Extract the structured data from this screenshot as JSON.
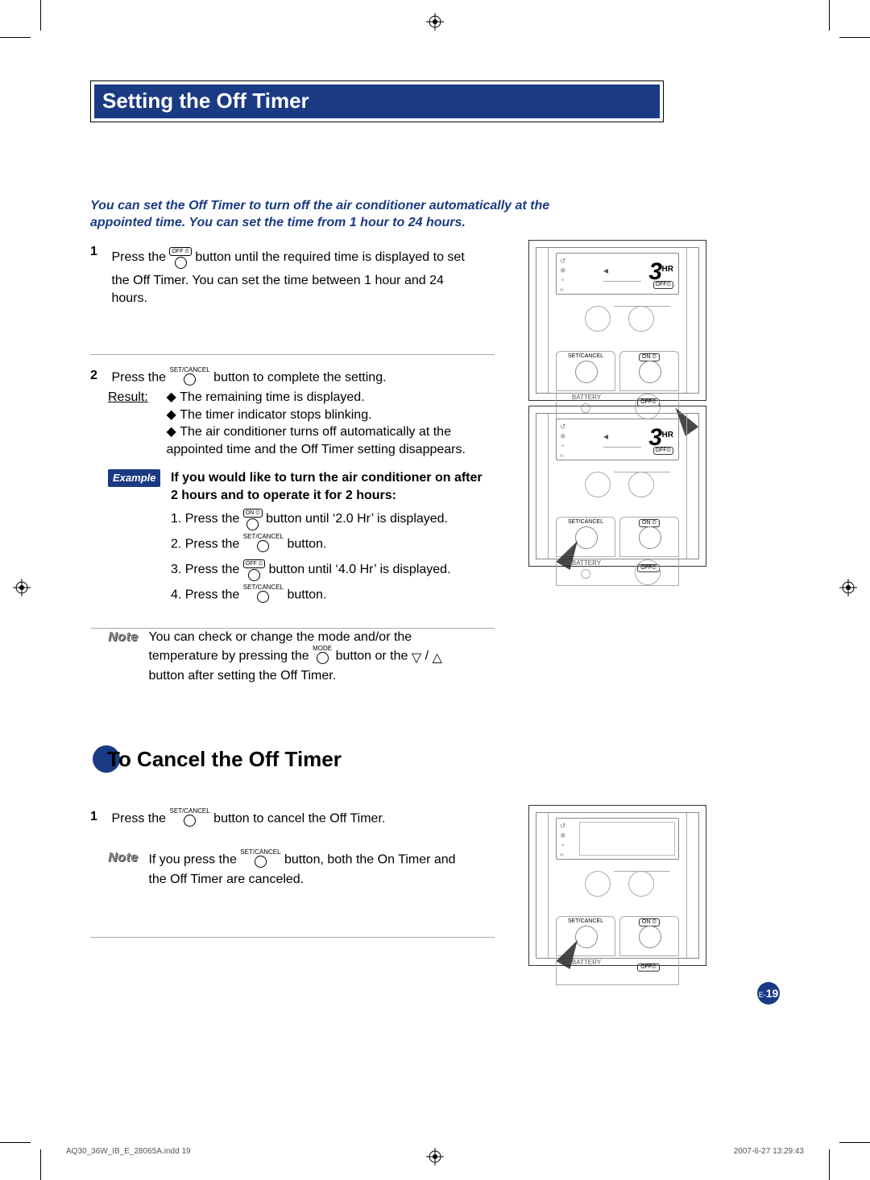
{
  "title": "Setting the Off Timer",
  "intro": "You can set the Off Timer to turn off the air conditioner automatically at the appointed time. You can set the time from 1 hour to 24 hours.",
  "icons": {
    "off_pill": "OFF ⏲",
    "on_pill": "ON ⏲",
    "set_cancel": "SET/CANCEL",
    "mode": "MODE",
    "battery": "BATTERY",
    "hr": "HR"
  },
  "step1": {
    "num": "1",
    "pre": "Press the ",
    "post": " button until the required time is displayed to set the Off Timer. You can set the time between 1 hour and 24 hours."
  },
  "step2": {
    "num": "2",
    "pre": "Press the ",
    "post": " button to complete the setting.",
    "result_label": "Result:",
    "bullets": [
      "The remaining time is displayed.",
      "The timer indicator stops blinking.",
      "The air conditioner turns off automatically at the appointed time and the Off Timer setting disappears."
    ],
    "example_label": "Example",
    "example_head": "If you would like to turn the air conditioner on after 2 hours and to operate it for 2 hours:",
    "ex1_pre": "1. Press the ",
    "ex1_post": " button until ‘2.0 Hr’ is displayed.",
    "ex2_pre": "2. Press the ",
    "ex2_post": " button.",
    "ex3_pre": "3. Press the ",
    "ex3_post": " button until ‘4.0 Hr’ is displayed.",
    "ex4_pre": "4. Press the ",
    "ex4_post": " button.",
    "note_label": "Note",
    "note_pre": "You can check or change the mode and/or the temperature by pressing the ",
    "note_mid": " button or the ",
    "note_post": " button after setting the Off Timer."
  },
  "cancel_title": "To Cancel the Off Timer",
  "cancel": {
    "num": "1",
    "pre": "Press the ",
    "post": " button to cancel the Off Timer.",
    "note_label": "Note",
    "note_pre": "If you press the ",
    "note_post": " button, both the On Timer and the Off Timer are canceled."
  },
  "remote": {
    "big": "3",
    "hr": "HR",
    "off": "OFF⏲",
    "on": "ON ⏲",
    "set_cancel": "SET/CANCEL",
    "battery": "BATTERY",
    "modes": "↺\n❄\n◔\n≈"
  },
  "page": {
    "prefix": "E-",
    "num": "19"
  },
  "footer": {
    "left": "AQ30_36W_IB_E_28065A.indd   19",
    "right": "2007-6-27   13:29:43"
  }
}
